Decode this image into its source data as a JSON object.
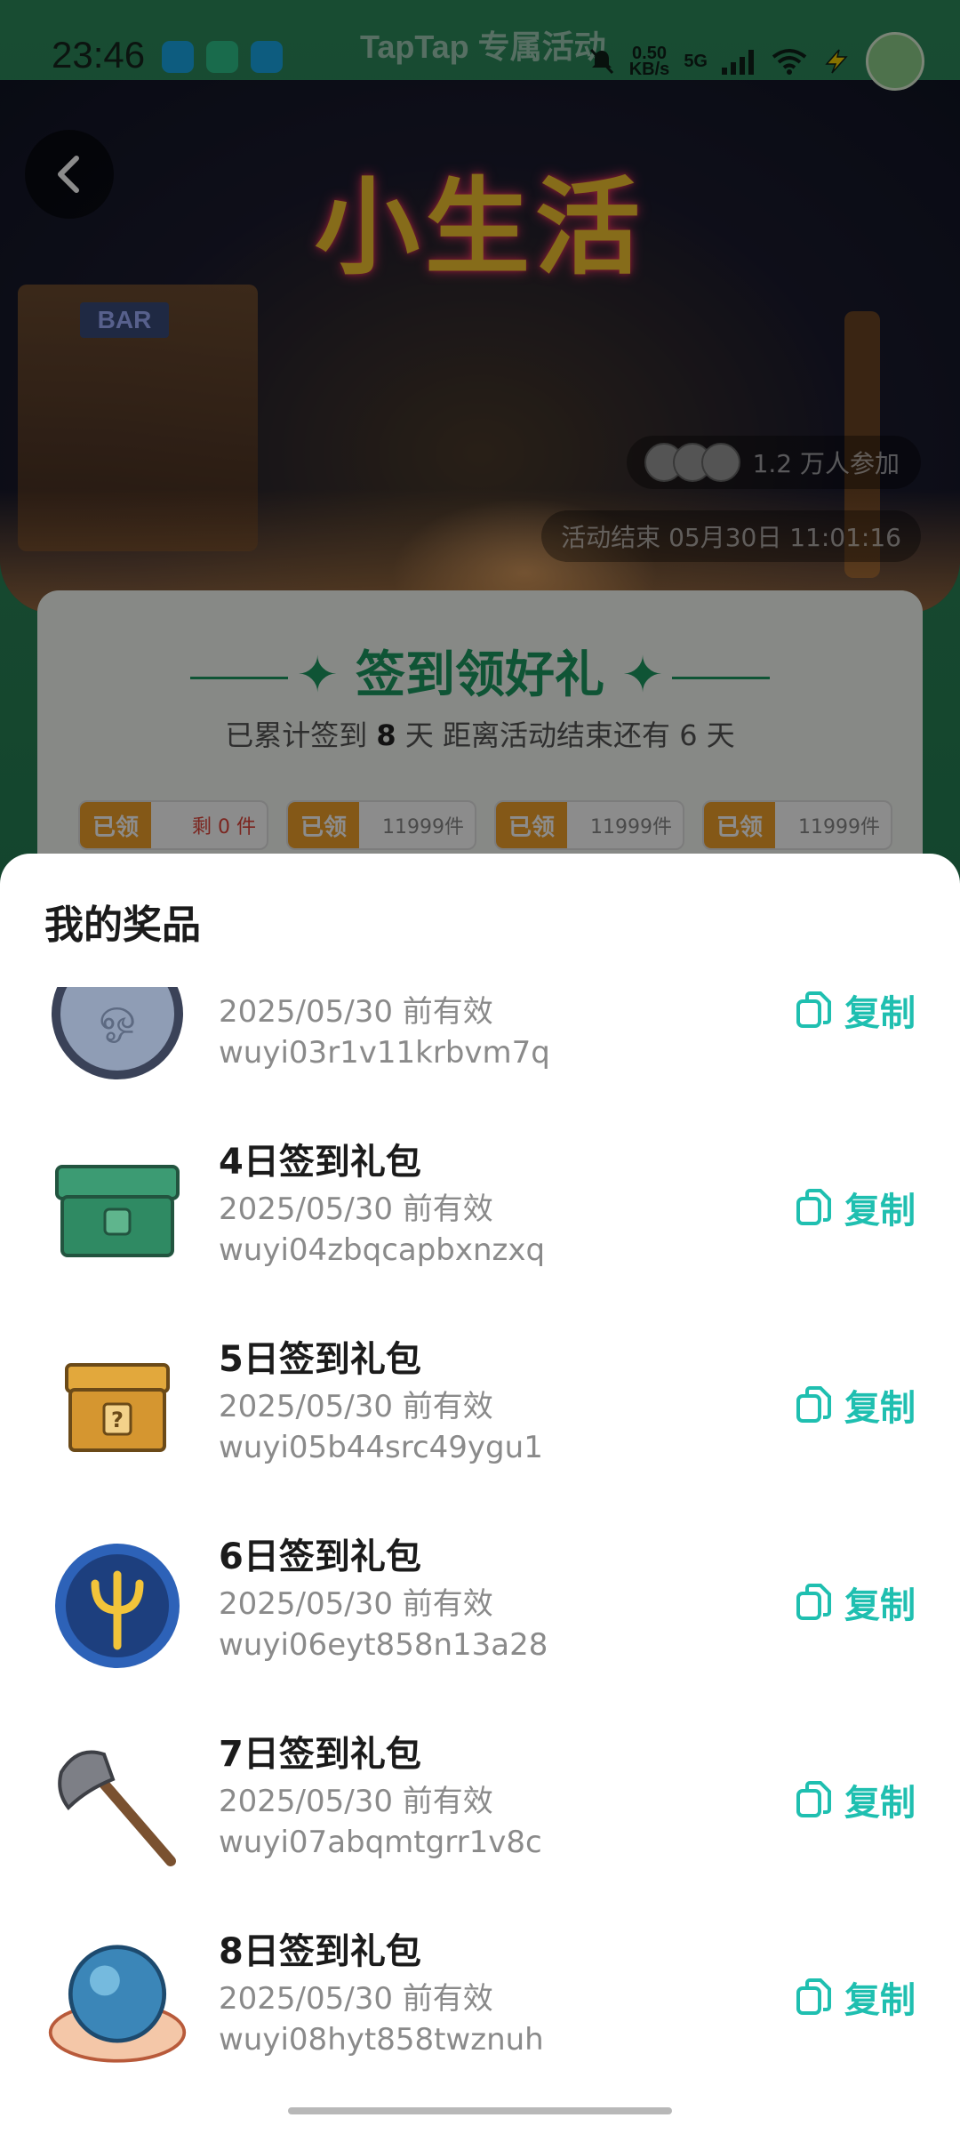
{
  "status_bar": {
    "time": "23:46",
    "brand": "TapTap 专属活动",
    "net_speed": "0.50",
    "net_unit": "KB/s",
    "network": "5G"
  },
  "banner": {
    "title": "小生活",
    "bar_sign": "BAR",
    "participants": "1.2 万人参加",
    "end_time": "活动结束 05月30日 11:01:16"
  },
  "checkin": {
    "title": "签到领好礼",
    "subtitle_prefix": "已累计签到",
    "days_signed": "8",
    "subtitle_mid": "天  距离活动结束还有",
    "days_left": "6",
    "subtitle_suffix": "天",
    "rewards": [
      {
        "status": "已领",
        "remaining": "剩 0 件"
      },
      {
        "status": "已领",
        "remaining": "11999件"
      },
      {
        "status": "已领",
        "remaining": "11999件"
      },
      {
        "status": "已领",
        "remaining": "11999件"
      }
    ]
  },
  "prizes": {
    "title": "我的奖品",
    "copy_label": "复制",
    "items": [
      {
        "name": "",
        "valid": "2025/05/30 前有效",
        "code": "wuyi03r1v11krbvm7q",
        "icon": "coin-icon"
      },
      {
        "name": "4日签到礼包",
        "valid": "2025/05/30 前有效",
        "code": "wuyi04zbqcapbxnzxq",
        "icon": "green-chest-icon"
      },
      {
        "name": "5日签到礼包",
        "valid": "2025/05/30 前有效",
        "code": "wuyi05b44src49ygu1",
        "icon": "mystery-box-icon"
      },
      {
        "name": "6日签到礼包",
        "valid": "2025/05/30 前有效",
        "code": "wuyi06eyt858n13a28",
        "icon": "trident-badge-icon"
      },
      {
        "name": "7日签到礼包",
        "valid": "2025/05/30 前有效",
        "code": "wuyi07abqmtgrr1v8c",
        "icon": "axe-icon"
      },
      {
        "name": "8日签到礼包",
        "valid": "2025/05/30 前有效",
        "code": "wuyi08hyt858twznuh",
        "icon": "crystal-ball-icon"
      }
    ]
  },
  "colors": {
    "accent": "#1fbfb0",
    "brand_green": "#1c9a62",
    "reward_orange": "#f0a12a"
  }
}
